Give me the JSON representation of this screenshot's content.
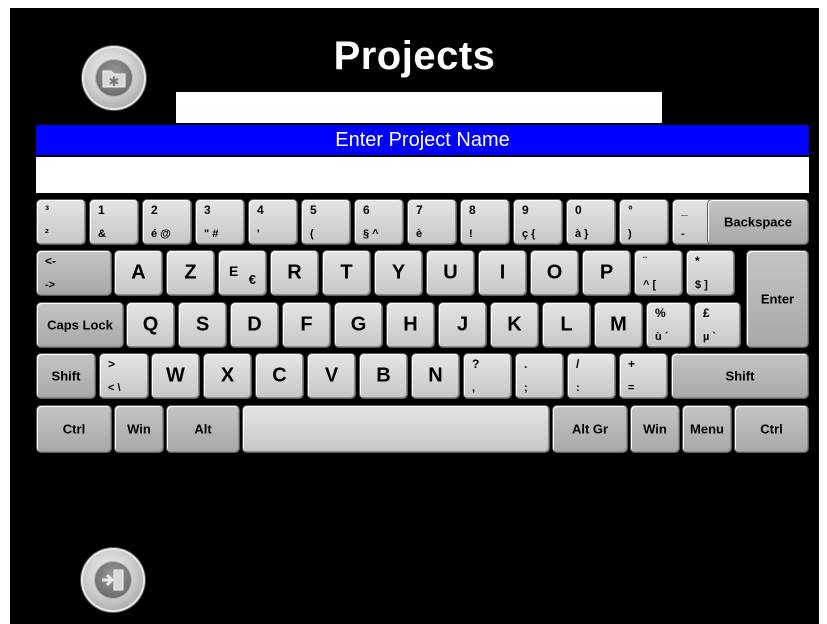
{
  "header": {
    "title": "Projects"
  },
  "prompt": {
    "label": "Enter Project Name"
  },
  "name_input": {
    "value": "",
    "placeholder": ""
  },
  "buttons": {
    "projects_icon": "folder-asterisk-icon",
    "exit_icon": "exit-door-icon"
  },
  "colors": {
    "background": "#000000",
    "prompt_bar": "#0000ff",
    "key_face": "#d4d4d4"
  },
  "keyboard": {
    "row1": [
      {
        "top": "³",
        "bottom": "²"
      },
      {
        "top": "1",
        "bottom": "&"
      },
      {
        "top": "2",
        "bottom": "é @"
      },
      {
        "top": "3",
        "bottom": "\" #"
      },
      {
        "top": "4",
        "bottom": "'"
      },
      {
        "top": "5",
        "bottom": "("
      },
      {
        "top": "6",
        "bottom": "§ ^"
      },
      {
        "top": "7",
        "bottom": "è"
      },
      {
        "top": "8",
        "bottom": "!"
      },
      {
        "top": "9",
        "bottom": "ç {"
      },
      {
        "top": "0",
        "bottom": "à }"
      },
      {
        "top": "°",
        "bottom": ")"
      },
      {
        "top": "_",
        "bottom": "-"
      }
    ],
    "backspace": "Backspace",
    "row2_arrow_top": "<-",
    "row2_arrow_bottom": "->",
    "row2_letters": [
      "A",
      "Z",
      "E",
      "R",
      "T",
      "Y",
      "U",
      "I",
      "O",
      "P"
    ],
    "e_euro": "€",
    "row2_sym1": {
      "top": "¨",
      "bottom": "^ ["
    },
    "row2_sym2": {
      "top": "*",
      "bottom": "$ ]"
    },
    "enter": "Enter",
    "caps_lock": "Caps Lock",
    "row3_letters": [
      "Q",
      "S",
      "D",
      "F",
      "G",
      "H",
      "J",
      "K",
      "L",
      "M"
    ],
    "row3_sym1": {
      "top": "%",
      "bottom": "ù ´"
    },
    "row3_sym2": {
      "top": "£",
      "bottom": "µ `"
    },
    "shift_left": "Shift",
    "row4_angle": {
      "top": ">",
      "bottom": "< \\"
    },
    "row4_letters": [
      "W",
      "X",
      "C",
      "V",
      "B",
      "N"
    ],
    "row4_syms": [
      {
        "top": "?",
        "bottom": ","
      },
      {
        "top": ".",
        "bottom": ";"
      },
      {
        "top": "/",
        "bottom": ":"
      },
      {
        "top": "+",
        "bottom": "="
      }
    ],
    "shift_right": "Shift",
    "bottom_row": {
      "ctrl_left": "Ctrl",
      "win_left": "Win",
      "alt": "Alt",
      "alt_gr": "Alt Gr",
      "win_right": "Win",
      "menu": "Menu",
      "ctrl_right": "Ctrl"
    }
  }
}
